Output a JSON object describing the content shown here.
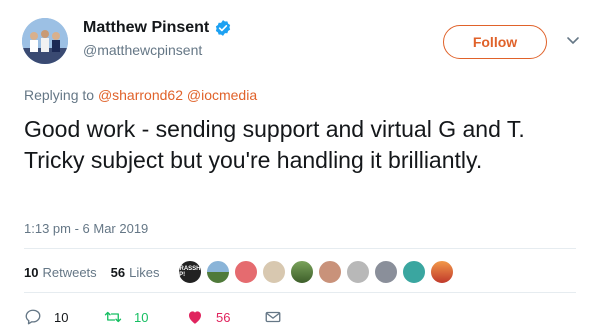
{
  "user": {
    "display_name": "Matthew Pinsent",
    "handle": "@matthewcpinsent"
  },
  "follow_label": "Follow",
  "reply": {
    "prefix": "Replying to",
    "mention1": "@sharrond62",
    "mention2": "@iocmedia"
  },
  "tweet_text": "Good work - sending support and virtual G and T. Tricky subject but you're handling it brilliantly.",
  "timestamp": "1:13 pm - 6 Mar 2019",
  "stats": {
    "retweets_count": "10",
    "retweets_label": "Retweets",
    "likes_count": "56",
    "likes_label": "Likes"
  },
  "liker_badge_text": "GRASSHO UP!",
  "actions": {
    "replies": "10",
    "retweets": "10",
    "likes": "56"
  },
  "colors": {
    "accent": "#e0622a",
    "verified": "#1da1f2",
    "like": "#e0245e",
    "retweet": "#17bf63",
    "muted": "#657786"
  },
  "icons": {
    "verified": "verified-badge-icon",
    "caret": "chevron-down-icon",
    "reply": "reply-icon",
    "retweet": "retweet-icon",
    "like": "heart-icon",
    "dm": "envelope-icon"
  }
}
